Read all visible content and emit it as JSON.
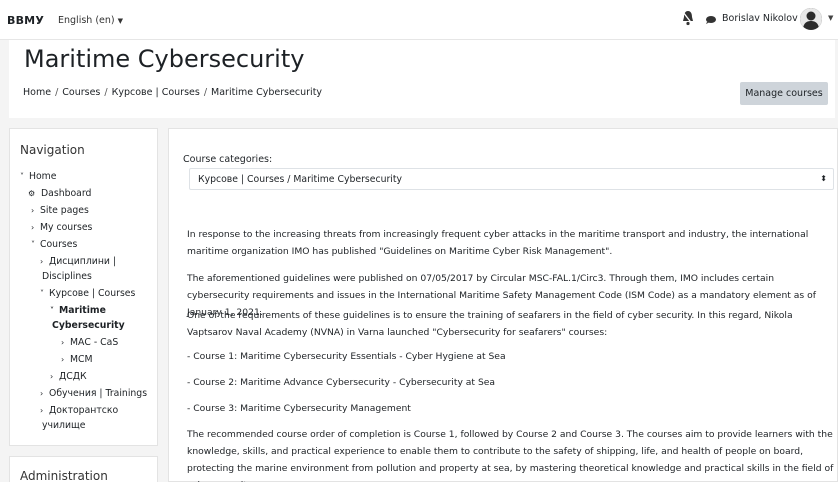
{
  "topbar": {
    "brand": "ВВМУ",
    "language": "English (en)",
    "user_name": "Borislav Nikolov"
  },
  "header": {
    "title": "Maritime Cybersecurity",
    "breadcrumb": [
      "Home",
      "Courses",
      "Курсове | Courses",
      "Maritime Cybersecurity"
    ],
    "manage_button": "Manage courses"
  },
  "navigation": {
    "title": "Navigation",
    "items": [
      {
        "label": "Home",
        "chevron": "˅"
      },
      {
        "label": "Dashboard",
        "chevron": ""
      },
      {
        "label": "Site pages",
        "chevron": "›"
      },
      {
        "label": "My courses",
        "chevron": "›"
      },
      {
        "label": "Courses",
        "chevron": "˅"
      },
      {
        "label": "Дисциплини |",
        "chevron": "›"
      },
      {
        "label": "Disciplines",
        "chevron": ""
      },
      {
        "label": "Курсове | Courses",
        "chevron": "˅"
      },
      {
        "label": "Maritime",
        "chevron": "˅"
      },
      {
        "label": "Cybersecurity",
        "chevron": ""
      },
      {
        "label": "МАС - CaS",
        "chevron": "›"
      },
      {
        "label": "МСМ",
        "chevron": "›"
      },
      {
        "label": "ДСДК",
        "chevron": "›"
      },
      {
        "label": "Обучения | Trainings",
        "chevron": "›"
      },
      {
        "label": "Докторантско",
        "chevron": "›"
      },
      {
        "label": "училище",
        "chevron": ""
      }
    ]
  },
  "administration": {
    "title": "Administration"
  },
  "main": {
    "category_label": "Course categories:",
    "category_value": "Курсове | Courses / Maritime Cybersecurity",
    "paragraphs": [
      "In response to the increasing threats from increasingly frequent cyber attacks in the maritime transport and industry, the international maritime organization IMO has published \"Guidelines on Maritime Cyber Risk Management\".",
      "The aforementioned guidelines were published on 07/05/2017 by Circular MSC-FAL.1/Circ3. Through them, IMO includes certain cybersecurity requirements and issues in the International Maritime Safety Management Code (ISM Code) as a mandatory element as of January 1, 2021.",
      "One of the requirements of these guidelines is to ensure the training of seafarers in the field of cyber security. In this regard, Nikola Vaptsarov Naval Academy (NVNA) in Varna launched \"Cybersecurity for seafarers\" courses:",
      "- Course 1: Maritime Cybersecurity Essentials - Cyber Hygiene at Sea",
      "- Course 2: Maritime Advance Cybersecurity - Cybersecurity at Sea",
      "- Course 3: Maritime Cybersecurity Management",
      "The recommended course order of completion is Course 1, followed by Course 2 and Course 3. The courses aim to provide learners with the knowledge, skills, and practical experience to enable them to contribute to the safety of shipping, life, and health of people on board, protecting the marine environment from pollution and property at sea, by mastering theoretical knowledge and practical skills in the field of cyber security."
    ]
  }
}
